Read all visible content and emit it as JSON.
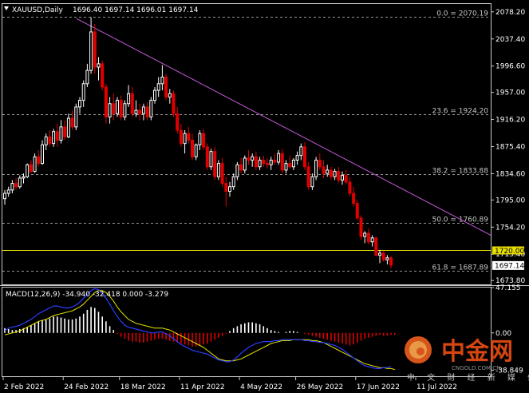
{
  "header": {
    "symbol": "XAUUSD,Daily",
    "ohlc": "1696.40 1697.14 1696.01 1697.14"
  },
  "macd_header": "MACD(12,26,9) -34.940 -32.418 0.000 -3.279",
  "colors": {
    "background": "#000000",
    "bull": "#ffffff",
    "bear": "#e00000",
    "trendline": "#c45ad8",
    "level_line": "#e8e000",
    "macd_line": "#2b3cff",
    "signal_line": "#e6e600",
    "grid": "#c8c8c8"
  },
  "price_axis_labels": [
    "2078.20",
    "2037.40",
    "1996.60",
    "1957.00",
    "1916.20",
    "1875.40",
    "1834.60",
    "1795.00",
    "1754.20",
    "1713.40",
    "1673.80"
  ],
  "current_price_label": "1697.14",
  "level_label": "1720.00",
  "macd_axis_labels": [
    "47.155",
    "0.00",
    "-38.849"
  ],
  "date_labels": [
    "2 Feb 2022",
    "24 Feb 2022",
    "18 Mar 2022",
    "11 Apr 2022",
    "4 May 2022",
    "26 May 2022",
    "17 Jun 2022",
    "11 Jul 2022"
  ],
  "watermark": {
    "brand": "中金网",
    "domain": "CNGOLD.COM.CN",
    "subtitle": "中 文 财 经 新 媒 体"
  },
  "chart_data": {
    "type": "candlestick",
    "title": "XAUUSD,Daily",
    "price_range": [
      1668,
      2090
    ],
    "fib_levels": [
      {
        "label": "0.0 = 2070.19",
        "price": 2070.19
      },
      {
        "label": "23.6 = 1924.20",
        "price": 1924.2
      },
      {
        "label": "38.2 = 1833.88",
        "price": 1833.88
      },
      {
        "label": "50.0 = 1760.89",
        "price": 1760.89
      },
      {
        "label": "61.8 = 1687.89",
        "price": 1687.89
      }
    ],
    "horizontal_level": 1720.0,
    "trendline": [
      {
        "i": 0,
        "price": 2068
      },
      {
        "i": 122,
        "price": 1742
      }
    ],
    "candles": [
      {
        "o": 1797,
        "h": 1810,
        "l": 1788,
        "c": 1805
      },
      {
        "o": 1805,
        "h": 1815,
        "l": 1800,
        "c": 1810
      },
      {
        "o": 1810,
        "h": 1825,
        "l": 1805,
        "c": 1820
      },
      {
        "o": 1820,
        "h": 1828,
        "l": 1810,
        "c": 1815
      },
      {
        "o": 1815,
        "h": 1832,
        "l": 1812,
        "c": 1828
      },
      {
        "o": 1828,
        "h": 1835,
        "l": 1820,
        "c": 1830
      },
      {
        "o": 1830,
        "h": 1850,
        "l": 1828,
        "c": 1848
      },
      {
        "o": 1848,
        "h": 1855,
        "l": 1835,
        "c": 1838
      },
      {
        "o": 1838,
        "h": 1865,
        "l": 1836,
        "c": 1860
      },
      {
        "o": 1860,
        "h": 1870,
        "l": 1845,
        "c": 1850
      },
      {
        "o": 1850,
        "h": 1885,
        "l": 1848,
        "c": 1878
      },
      {
        "o": 1878,
        "h": 1895,
        "l": 1870,
        "c": 1890
      },
      {
        "o": 1890,
        "h": 1900,
        "l": 1875,
        "c": 1880
      },
      {
        "o": 1880,
        "h": 1902,
        "l": 1875,
        "c": 1898
      },
      {
        "o": 1898,
        "h": 1910,
        "l": 1875,
        "c": 1885
      },
      {
        "o": 1885,
        "h": 1915,
        "l": 1880,
        "c": 1905
      },
      {
        "o": 1905,
        "h": 1915,
        "l": 1885,
        "c": 1890
      },
      {
        "o": 1890,
        "h": 1925,
        "l": 1888,
        "c": 1918
      },
      {
        "o": 1918,
        "h": 1930,
        "l": 1900,
        "c": 1905
      },
      {
        "o": 1905,
        "h": 1940,
        "l": 1900,
        "c": 1935
      },
      {
        "o": 1935,
        "h": 1950,
        "l": 1925,
        "c": 1945
      },
      {
        "o": 1945,
        "h": 1975,
        "l": 1935,
        "c": 1970
      },
      {
        "o": 1970,
        "h": 2000,
        "l": 1965,
        "c": 1990
      },
      {
        "o": 1990,
        "h": 2070,
        "l": 1985,
        "c": 2048
      },
      {
        "o": 2048,
        "h": 2060,
        "l": 1985,
        "c": 1995
      },
      {
        "o": 1995,
        "h": 2010,
        "l": 1975,
        "c": 2000
      },
      {
        "o": 2000,
        "h": 2005,
        "l": 1960,
        "c": 1965
      },
      {
        "o": 1965,
        "h": 1970,
        "l": 1910,
        "c": 1920
      },
      {
        "o": 1920,
        "h": 1950,
        "l": 1910,
        "c": 1940
      },
      {
        "o": 1940,
        "h": 1955,
        "l": 1915,
        "c": 1925
      },
      {
        "o": 1925,
        "h": 1950,
        "l": 1920,
        "c": 1945
      },
      {
        "o": 1945,
        "h": 1952,
        "l": 1915,
        "c": 1920
      },
      {
        "o": 1920,
        "h": 1945,
        "l": 1915,
        "c": 1940
      },
      {
        "o": 1940,
        "h": 1968,
        "l": 1935,
        "c": 1955
      },
      {
        "o": 1955,
        "h": 1965,
        "l": 1920,
        "c": 1925
      },
      {
        "o": 1925,
        "h": 1945,
        "l": 1920,
        "c": 1930
      },
      {
        "o": 1930,
        "h": 1940,
        "l": 1915,
        "c": 1925
      },
      {
        "o": 1925,
        "h": 1940,
        "l": 1915,
        "c": 1935
      },
      {
        "o": 1935,
        "h": 1942,
        "l": 1915,
        "c": 1920
      },
      {
        "o": 1920,
        "h": 1950,
        "l": 1915,
        "c": 1945
      },
      {
        "o": 1945,
        "h": 1965,
        "l": 1940,
        "c": 1960
      },
      {
        "o": 1960,
        "h": 1980,
        "l": 1950,
        "c": 1970
      },
      {
        "o": 1970,
        "h": 1998,
        "l": 1960,
        "c": 1980
      },
      {
        "o": 1980,
        "h": 1985,
        "l": 1945,
        "c": 1950
      },
      {
        "o": 1950,
        "h": 1962,
        "l": 1940,
        "c": 1955
      },
      {
        "o": 1955,
        "h": 1960,
        "l": 1920,
        "c": 1925
      },
      {
        "o": 1925,
        "h": 1935,
        "l": 1895,
        "c": 1900
      },
      {
        "o": 1900,
        "h": 1910,
        "l": 1875,
        "c": 1880
      },
      {
        "o": 1880,
        "h": 1900,
        "l": 1865,
        "c": 1895
      },
      {
        "o": 1895,
        "h": 1905,
        "l": 1880,
        "c": 1885
      },
      {
        "o": 1885,
        "h": 1895,
        "l": 1855,
        "c": 1860
      },
      {
        "o": 1860,
        "h": 1880,
        "l": 1855,
        "c": 1878
      },
      {
        "o": 1878,
        "h": 1900,
        "l": 1870,
        "c": 1895
      },
      {
        "o": 1895,
        "h": 1902,
        "l": 1870,
        "c": 1875
      },
      {
        "o": 1875,
        "h": 1880,
        "l": 1840,
        "c": 1845
      },
      {
        "o": 1845,
        "h": 1872,
        "l": 1840,
        "c": 1868
      },
      {
        "o": 1868,
        "h": 1875,
        "l": 1825,
        "c": 1830
      },
      {
        "o": 1830,
        "h": 1855,
        "l": 1825,
        "c": 1850
      },
      {
        "o": 1850,
        "h": 1858,
        "l": 1815,
        "c": 1820
      },
      {
        "o": 1820,
        "h": 1830,
        "l": 1785,
        "c": 1808
      },
      {
        "o": 1808,
        "h": 1822,
        "l": 1800,
        "c": 1815
      },
      {
        "o": 1815,
        "h": 1835,
        "l": 1810,
        "c": 1830
      },
      {
        "o": 1830,
        "h": 1852,
        "l": 1825,
        "c": 1848
      },
      {
        "o": 1848,
        "h": 1858,
        "l": 1835,
        "c": 1840
      },
      {
        "o": 1840,
        "h": 1862,
        "l": 1835,
        "c": 1858
      },
      {
        "o": 1858,
        "h": 1870,
        "l": 1848,
        "c": 1855
      },
      {
        "o": 1855,
        "h": 1865,
        "l": 1845,
        "c": 1860
      },
      {
        "o": 1860,
        "h": 1868,
        "l": 1840,
        "c": 1845
      },
      {
        "o": 1845,
        "h": 1860,
        "l": 1840,
        "c": 1855
      },
      {
        "o": 1855,
        "h": 1862,
        "l": 1845,
        "c": 1850
      },
      {
        "o": 1850,
        "h": 1858,
        "l": 1842,
        "c": 1848
      },
      {
        "o": 1848,
        "h": 1860,
        "l": 1840,
        "c": 1855
      },
      {
        "o": 1855,
        "h": 1865,
        "l": 1848,
        "c": 1852
      },
      {
        "o": 1852,
        "h": 1870,
        "l": 1848,
        "c": 1865
      },
      {
        "o": 1865,
        "h": 1872,
        "l": 1835,
        "c": 1840
      },
      {
        "o": 1840,
        "h": 1855,
        "l": 1835,
        "c": 1850
      },
      {
        "o": 1850,
        "h": 1862,
        "l": 1842,
        "c": 1845
      },
      {
        "o": 1845,
        "h": 1858,
        "l": 1840,
        "c": 1855
      },
      {
        "o": 1855,
        "h": 1868,
        "l": 1848,
        "c": 1862
      },
      {
        "o": 1862,
        "h": 1880,
        "l": 1855,
        "c": 1875
      },
      {
        "o": 1875,
        "h": 1882,
        "l": 1840,
        "c": 1845
      },
      {
        "o": 1845,
        "h": 1852,
        "l": 1810,
        "c": 1815
      },
      {
        "o": 1815,
        "h": 1835,
        "l": 1810,
        "c": 1830
      },
      {
        "o": 1830,
        "h": 1860,
        "l": 1825,
        "c": 1855
      },
      {
        "o": 1855,
        "h": 1865,
        "l": 1840,
        "c": 1845
      },
      {
        "o": 1845,
        "h": 1855,
        "l": 1828,
        "c": 1835
      },
      {
        "o": 1835,
        "h": 1848,
        "l": 1830,
        "c": 1840
      },
      {
        "o": 1840,
        "h": 1845,
        "l": 1825,
        "c": 1830
      },
      {
        "o": 1830,
        "h": 1842,
        "l": 1825,
        "c": 1838
      },
      {
        "o": 1838,
        "h": 1845,
        "l": 1820,
        "c": 1825
      },
      {
        "o": 1825,
        "h": 1838,
        "l": 1818,
        "c": 1832
      },
      {
        "o": 1832,
        "h": 1840,
        "l": 1818,
        "c": 1822
      },
      {
        "o": 1822,
        "h": 1830,
        "l": 1800,
        "c": 1805
      },
      {
        "o": 1805,
        "h": 1815,
        "l": 1785,
        "c": 1790
      },
      {
        "o": 1790,
        "h": 1795,
        "l": 1765,
        "c": 1768
      },
      {
        "o": 1768,
        "h": 1772,
        "l": 1735,
        "c": 1740
      },
      {
        "o": 1740,
        "h": 1748,
        "l": 1730,
        "c": 1745
      },
      {
        "o": 1745,
        "h": 1752,
        "l": 1728,
        "c": 1732
      },
      {
        "o": 1732,
        "h": 1742,
        "l": 1725,
        "c": 1738
      },
      {
        "o": 1738,
        "h": 1740,
        "l": 1710,
        "c": 1712
      },
      {
        "o": 1712,
        "h": 1720,
        "l": 1700,
        "c": 1715
      },
      {
        "o": 1715,
        "h": 1718,
        "l": 1702,
        "c": 1705
      },
      {
        "o": 1705,
        "h": 1712,
        "l": 1698,
        "c": 1708
      },
      {
        "o": 1708,
        "h": 1710,
        "l": 1692,
        "c": 1697
      }
    ],
    "macd_range": [
      -45,
      47.155
    ],
    "macd": {
      "histogram": [
        5,
        4,
        3,
        3,
        4,
        5,
        6,
        8,
        10,
        12,
        13,
        14,
        15,
        17,
        17,
        16,
        15,
        14,
        14,
        15,
        17,
        20,
        24,
        27,
        26,
        22,
        17,
        12,
        7,
        3,
        -1,
        -4,
        -6,
        -8,
        -9,
        -9,
        -10,
        -10,
        -9,
        -8,
        -7,
        -6,
        -6,
        -7,
        -8,
        -9,
        -10,
        -11,
        -12,
        -13,
        -14,
        -14,
        -13,
        -12,
        -11,
        -9,
        -7,
        -5,
        -3,
        -1,
        2,
        5,
        7,
        9,
        10,
        11,
        11,
        10,
        9,
        7,
        5,
        3,
        2,
        1,
        0,
        1,
        2,
        2,
        1,
        0,
        -1,
        -2,
        -3,
        -4,
        -5,
        -6,
        -7,
        -8,
        -9,
        -10,
        -11,
        -12,
        -13,
        -12,
        -10,
        -8,
        -6,
        -5,
        -4,
        -3,
        -2,
        -3,
        -3,
        -2,
        -2
      ],
      "macd_line": [
        2,
        5,
        6,
        7,
        8,
        10,
        12,
        14,
        17,
        20,
        22,
        24,
        26,
        28,
        28,
        27,
        26,
        26,
        27,
        29,
        32,
        36,
        40,
        44,
        46,
        45,
        41,
        36,
        30,
        23,
        17,
        12,
        8,
        6,
        5,
        4,
        3,
        2,
        1,
        0,
        0,
        1,
        1,
        -1,
        -3,
        -6,
        -9,
        -12,
        -14,
        -16,
        -18,
        -19,
        -20,
        -21,
        -22,
        -24,
        -26,
        -28,
        -29,
        -30,
        -30,
        -28,
        -25,
        -21,
        -18,
        -15,
        -13,
        -11,
        -10,
        -9,
        -9,
        -9,
        -8,
        -8,
        -7,
        -7,
        -7,
        -7,
        -7,
        -7,
        -8,
        -8,
        -9,
        -9,
        -10,
        -10,
        -11,
        -12,
        -13,
        -15,
        -17,
        -20,
        -23,
        -26,
        -29,
        -32,
        -34,
        -35,
        -36,
        -37,
        -37,
        -36,
        -36,
        -35
      ],
      "signal_line": [
        -2,
        -1,
        0,
        1,
        2,
        4,
        6,
        8,
        10,
        12,
        13,
        14,
        16,
        18,
        19,
        20,
        21,
        22,
        23,
        25,
        27,
        30,
        34,
        38,
        42,
        44,
        44,
        42,
        38,
        33,
        27,
        22,
        18,
        14,
        12,
        10,
        9,
        8,
        7,
        6,
        5,
        5,
        5,
        4,
        3,
        1,
        -1,
        -3,
        -5,
        -7,
        -9,
        -11,
        -13,
        -15,
        -18,
        -21,
        -24,
        -27,
        -28,
        -29,
        -29,
        -29,
        -28,
        -27,
        -25,
        -23,
        -21,
        -19,
        -17,
        -15,
        -13,
        -11,
        -10,
        -9,
        -8,
        -8,
        -8,
        -7,
        -7,
        -7,
        -7,
        -7,
        -8,
        -8,
        -9,
        -10,
        -12,
        -14,
        -16,
        -18,
        -20,
        -22,
        -24,
        -26,
        -28,
        -30,
        -32,
        -33,
        -34,
        -35,
        -36,
        -36,
        -37,
        -37,
        -38
      ]
    }
  }
}
